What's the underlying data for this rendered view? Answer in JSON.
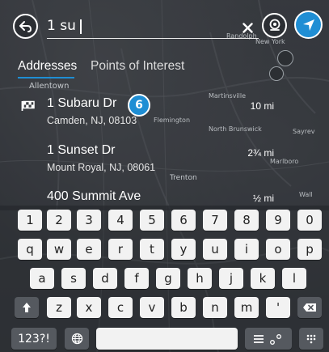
{
  "search": {
    "value": "1 su"
  },
  "tabs": {
    "addresses": "Addresses",
    "points_of_interest": "Points of Interest"
  },
  "results": [
    {
      "title": "1 Subaru Dr",
      "subtitle": "Camden, NJ, 08103",
      "distance": "10 mi",
      "badge": "6"
    },
    {
      "title": "1 Sunset Dr",
      "subtitle": "Mount Royal, NJ, 08061",
      "distance": "2¾ mi"
    },
    {
      "title": "400 Summit Ave",
      "subtitle": "",
      "distance": "½ mi"
    }
  ],
  "map_labels": [
    "Randolph",
    "New York",
    "Allentown",
    "Martinsville",
    "Flemington",
    "North Brunswick",
    "Marlboro",
    "Sayrev",
    "Trenton",
    "Wall"
  ],
  "keyboard": {
    "row1": [
      "1",
      "2",
      "3",
      "4",
      "5",
      "6",
      "7",
      "8",
      "9",
      "0"
    ],
    "row2": [
      "q",
      "w",
      "e",
      "r",
      "t",
      "y",
      "u",
      "i",
      "o",
      "p"
    ],
    "row3": [
      "a",
      "s",
      "d",
      "f",
      "g",
      "h",
      "j",
      "k",
      "l"
    ],
    "row4": [
      "z",
      "x",
      "c",
      "v",
      "b",
      "n",
      "m",
      "'"
    ],
    "mode_key": "123?!"
  },
  "icons": {
    "back": "back-arrow-icon",
    "clear": "close-icon",
    "voice": "microphone-icon",
    "navigation": "navigation-arrow-icon",
    "flag": "destination-flag-icon",
    "shift": "shift-up-arrow-icon",
    "backspace": "backspace-icon",
    "globe": "globe-icon",
    "search_options": "search-options-icon",
    "keyboard": "keyboard-icon"
  },
  "colors": {
    "accent": "#1f8ed4",
    "key_light": "#f2f2f2",
    "key_dark": "#55595f"
  }
}
